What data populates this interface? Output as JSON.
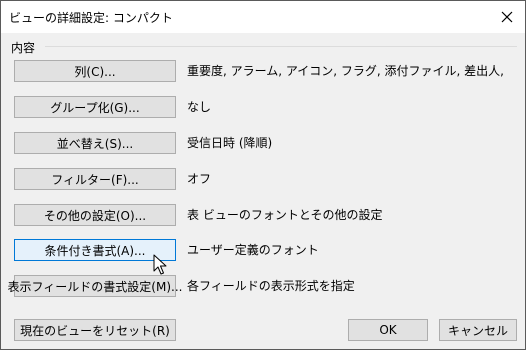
{
  "window": {
    "title": "ビューの詳細設定: コンパクト",
    "close_icon": "close-icon"
  },
  "content_group": {
    "label": "内容",
    "rows": [
      {
        "button": "列(C)...",
        "description": "重要度, アラーム, アイコン, フラグ, 添付ファイル, 差出人, 件名, 受信..."
      },
      {
        "button": "グループ化(G)...",
        "description": "なし"
      },
      {
        "button": "並べ替え(S)...",
        "description": "受信日時 (降順)"
      },
      {
        "button": "フィルター(F)...",
        "description": "オフ"
      },
      {
        "button": "その他の設定(O)...",
        "description": "表 ビューのフォントとその他の設定"
      },
      {
        "button": "条件付き書式(A)...",
        "description": "ユーザー定義のフォント"
      },
      {
        "button": "表示フィールドの書式設定(M)...",
        "description": "各フィールドの表示形式を指定"
      }
    ]
  },
  "footer": {
    "reset": "現在のビューをリセット(R)",
    "ok": "OK",
    "cancel": "キャンセル"
  },
  "colors": {
    "focus_border": "#0078d7",
    "button_face": "#e1e1e1",
    "dialog_bg": "#f0f0f0"
  }
}
